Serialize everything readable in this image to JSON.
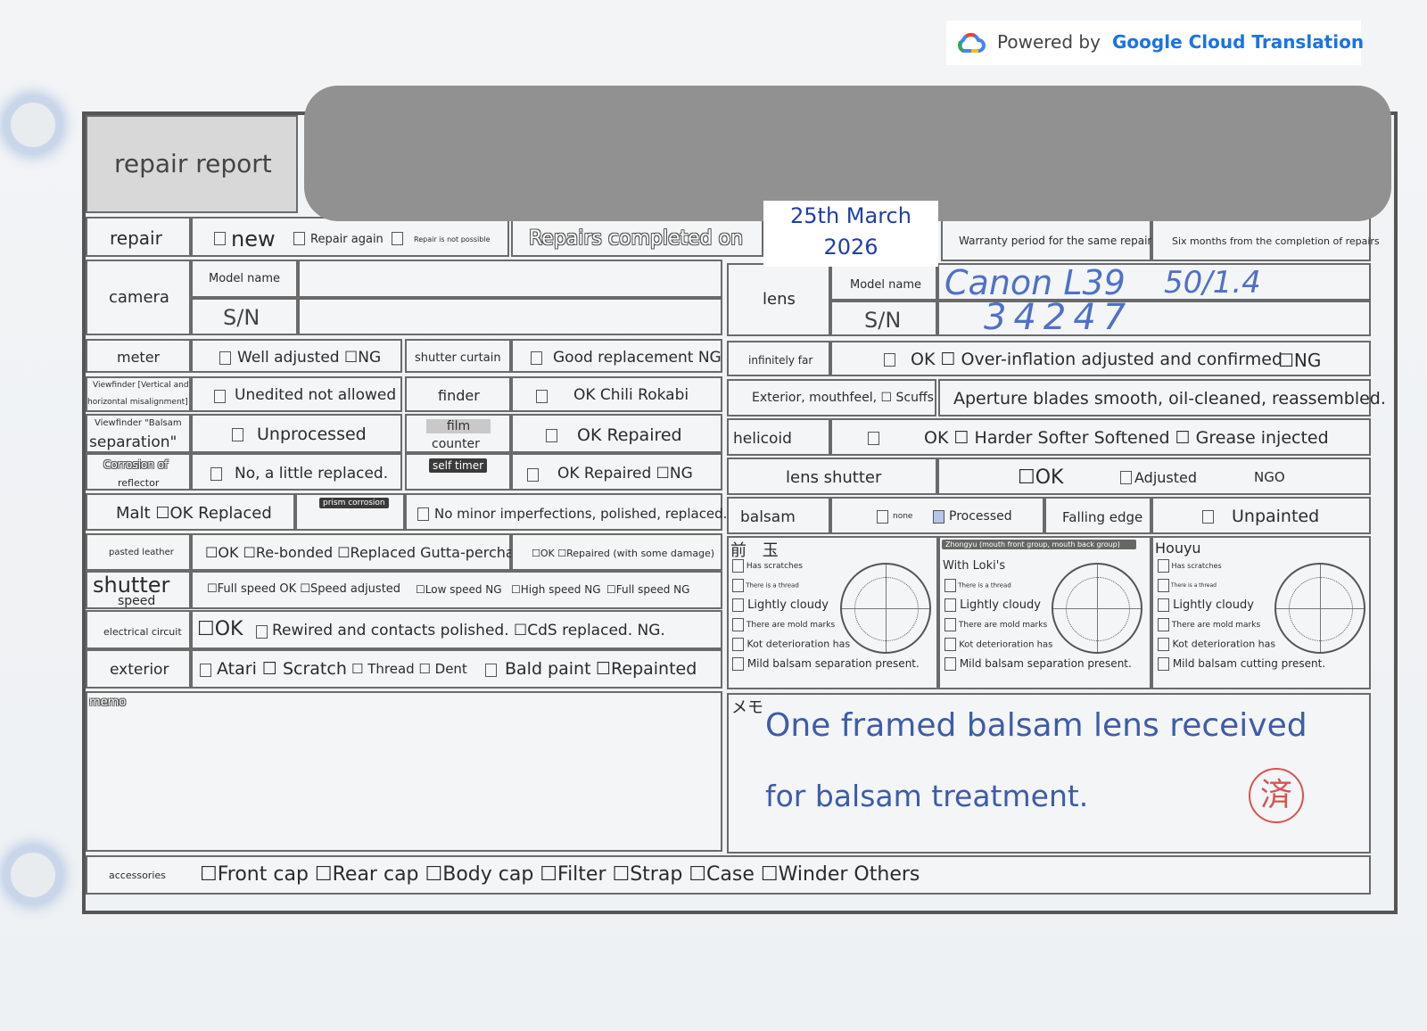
{
  "banner": {
    "prefix": "Powered by",
    "brand": "Google Cloud Translation"
  },
  "header": {
    "title": "repair report"
  },
  "repair": {
    "label": "repair",
    "new": "new",
    "again": "Repair again",
    "not_possible": "Repair is not possible",
    "completed": "Repairs completed on",
    "date": "25th March 2026",
    "warranty_label": "Warranty period for the same repair",
    "warranty_value": "Six months from the completion of repairs"
  },
  "camera": {
    "label": "camera",
    "model": "Model name",
    "sn": "S/N"
  },
  "lens": {
    "label": "lens",
    "model": "Model name",
    "sn": "S/N",
    "model_value": "Canon L39",
    "model_value2": "50/1.4",
    "sn_value": "34247"
  },
  "rows": {
    "meter": "meter",
    "meter_val": "Well adjusted ☐NG",
    "shutter_curtain": "shutter curtain",
    "shutter_curtain_val": "Good replacement NG",
    "infinitely_far": "infinitely far",
    "infinitely_far_val": "OK ☐ Over-inflation adjusted and confirmed",
    "infinitely_far_ng": "☐NG",
    "viewfinder1_a": "Viewfinder [Vertical and",
    "viewfinder1_b": "horizontal misalignment]",
    "viewfinder1_val": "Unedited not allowed",
    "finder": "finder",
    "finder_val": "OK Chili Rokabi",
    "exterior_lens": "Exterior, mouthfeel, ☐ Scuffs",
    "aperture": "Aperture blades smooth, oil-cleaned, reassembled.",
    "viewfinder2_a": "Viewfinder \"Balsam",
    "viewfinder2_b": "separation\"",
    "viewfinder2_val": "Unprocessed",
    "film_a": "film",
    "film_b": "counter",
    "film_val": "OK Repaired",
    "helicoid": "helicoid",
    "helicoid_val": "OK ☐ Harder Softer Softened ☐ Grease injected",
    "corrosion_a": "Corrosion of",
    "corrosion_b": "reflector",
    "corrosion_val": "No, a little replaced.",
    "self_timer": "self timer",
    "self_timer_val": "OK Repaired ☐NG",
    "lens_shutter": "lens shutter",
    "lens_shutter_ok": "☐OK",
    "lens_shutter_adj": "Adjusted",
    "lens_shutter_ngo": "NGO",
    "malt": "Malt ☐OK Replaced",
    "prism": "prism corrosion",
    "prism_val": "No minor imperfections, polished, replaced.",
    "balsam": "balsam",
    "balsam_none": "none",
    "balsam_processed": "Processed",
    "falling_edge": "Falling edge",
    "unpainted": "Unpainted",
    "leather": "pasted leather",
    "leather_val": "☐OK ☐Re-bonded ☐Replaced Gutta-percha",
    "leather_val2": "☐OK ☐Repaired (with some damage)",
    "shutter": "shutter",
    "speed": "speed",
    "speed_1": "☐Full speed OK ☐Speed adjusted",
    "speed_2": "☐Low speed NG",
    "speed_3": "☐High speed NG",
    "speed_4": "☐Full speed NG",
    "electrical": "electrical circuit",
    "electrical_ok": "☐OK",
    "electrical_val": "Rewired and contacts polished. ☐CdS replaced. NG.",
    "exterior": "exterior",
    "exterior_1": "Atari ☐ Scratch",
    "exterior_2": "☐ Thread ☐ Dent",
    "exterior_3": "Bald paint",
    "exterior_4": "☐Repainted"
  },
  "groups": {
    "front": {
      "title": "前 玉",
      "items": [
        "Has scratches",
        "There is a thread",
        "Lightly cloudy",
        "There are mold marks",
        "Kot deterioration has",
        "Mild balsam separation present."
      ]
    },
    "middle": {
      "title": "Zhongyu (mouth front group, mouth back group)",
      "subtitle": "With Loki's",
      "items": [
        "There is a thread",
        "Lightly cloudy",
        "There are mold marks",
        "Kot deterioration has",
        "Mild balsam separation present."
      ]
    },
    "rear": {
      "title": "Houyu",
      "items": [
        "Has scratches",
        "There is a thread",
        "Lightly cloudy",
        "There are mold marks",
        "Kot deterioration has",
        "Mild balsam cutting present."
      ]
    }
  },
  "memo": {
    "label": "memo",
    "label2": "メモ",
    "line1": "One framed balsam lens received",
    "line2": "for balsam treatment.",
    "stamp": "済"
  },
  "accessories": {
    "label": "accessories",
    "items": "☐Front cap ☐Rear cap ☐Body cap ☐Filter ☐Strap ☐Case ☐Winder Others"
  },
  "colors": {
    "redaction": "#919191",
    "handwriting": "#5070c8",
    "stamp": "#d9534f",
    "brand": "#1a73e8"
  }
}
